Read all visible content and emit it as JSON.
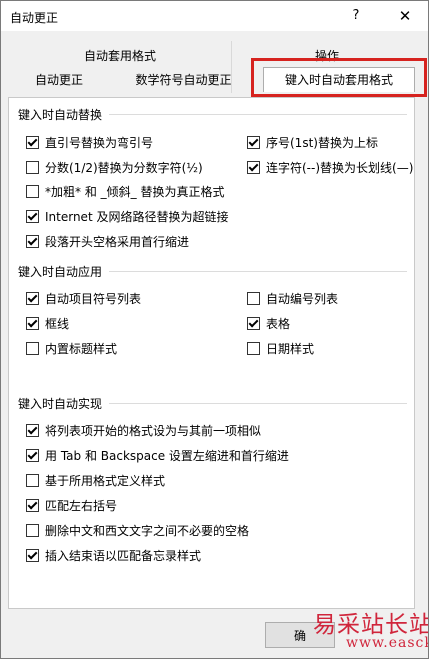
{
  "window": {
    "title": "自动更正",
    "help_glyph": "?",
    "close_glyph": "✕"
  },
  "tabs": {
    "row1": [
      {
        "label": "自动套用格式"
      },
      {
        "label": "操作"
      }
    ],
    "row2": [
      {
        "label": "自动更正"
      },
      {
        "label": "数学符号自动更正"
      },
      {
        "label": "键入时自动套用格式",
        "selected": true
      }
    ]
  },
  "groups": {
    "replace": {
      "title": "键入时自动替换",
      "items": [
        {
          "label": "直引号替换为弯引号",
          "checked": true
        },
        {
          "label": "序号(1st)替换为上标",
          "checked": true
        },
        {
          "label": "分数(1/2)替换为分数字符(½)",
          "checked": false
        },
        {
          "label": "连字符(--)替换为长划线(—)",
          "checked": true
        },
        {
          "label": "*加粗* 和 _倾斜_ 替换为真正格式",
          "checked": false
        },
        {
          "label": "Internet 及网络路径替换为超链接",
          "checked": true
        },
        {
          "label": "段落开头空格采用首行缩进",
          "checked": true
        }
      ]
    },
    "apply": {
      "title": "键入时自动应用",
      "items": [
        {
          "label": "自动项目符号列表",
          "checked": true
        },
        {
          "label": "自动编号列表",
          "checked": false
        },
        {
          "label": "框线",
          "checked": true
        },
        {
          "label": "表格",
          "checked": true
        },
        {
          "label": "内置标题样式",
          "checked": false
        },
        {
          "label": "日期样式",
          "checked": false
        }
      ]
    },
    "automatic": {
      "title": "键入时自动实现",
      "items": [
        {
          "label": "将列表项开始的格式设为与其前一项相似",
          "checked": true
        },
        {
          "label": "用 Tab 和 Backspace 设置左缩进和首行缩进",
          "checked": true
        },
        {
          "label": "基于所用格式定义样式",
          "checked": false
        },
        {
          "label": "匹配左右括号",
          "checked": true
        },
        {
          "label": "删除中文和西文文字之间不必要的空格",
          "checked": false
        },
        {
          "label": "插入结束语以匹配备忘录样式",
          "checked": true
        }
      ]
    }
  },
  "footer": {
    "ok_label": "确"
  },
  "watermark": {
    "text": "易采站长站",
    "url": "www.easck.com"
  },
  "colors": {
    "highlight": "#d6231f",
    "watermark": "#d0253b"
  }
}
